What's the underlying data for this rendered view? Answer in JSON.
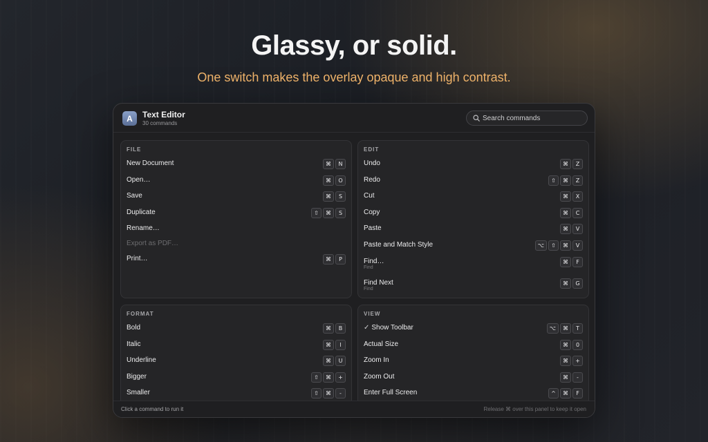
{
  "hero": {
    "title": "Glassy, or solid.",
    "subtitle": "One switch makes the overlay opaque and high contrast."
  },
  "header": {
    "app_icon_letter": "A",
    "app_name": "Text Editor",
    "command_count": "30 commands",
    "search_placeholder": "Search commands"
  },
  "sections": [
    {
      "title": "FILE",
      "items": [
        {
          "label": "New Document",
          "keys": [
            "⌘",
            "N"
          ]
        },
        {
          "label": "Open…",
          "keys": [
            "⌘",
            "O"
          ]
        },
        {
          "label": "Save",
          "keys": [
            "⌘",
            "S"
          ]
        },
        {
          "label": "Duplicate",
          "keys": [
            "⇧",
            "⌘",
            "S"
          ]
        },
        {
          "label": "Rename…",
          "keys": []
        },
        {
          "label": "Export as PDF…",
          "keys": [],
          "disabled": true
        },
        {
          "label": "Print…",
          "keys": [
            "⌘",
            "P"
          ]
        }
      ]
    },
    {
      "title": "EDIT",
      "items": [
        {
          "label": "Undo",
          "keys": [
            "⌘",
            "Z"
          ]
        },
        {
          "label": "Redo",
          "keys": [
            "⇧",
            "⌘",
            "Z"
          ]
        },
        {
          "label": "Cut",
          "keys": [
            "⌘",
            "X"
          ]
        },
        {
          "label": "Copy",
          "keys": [
            "⌘",
            "C"
          ]
        },
        {
          "label": "Paste",
          "keys": [
            "⌘",
            "V"
          ]
        },
        {
          "label": "Paste and Match Style",
          "keys": [
            "⌥",
            "⇧",
            "⌘",
            "V"
          ]
        },
        {
          "label": "Find…",
          "sub": "Find",
          "keys": [
            "⌘",
            "F"
          ]
        },
        {
          "label": "Find Next",
          "sub": "Find",
          "keys": [
            "⌘",
            "G"
          ]
        }
      ]
    },
    {
      "title": "FORMAT",
      "items": [
        {
          "label": "Bold",
          "keys": [
            "⌘",
            "B"
          ]
        },
        {
          "label": "Italic",
          "keys": [
            "⌘",
            "I"
          ]
        },
        {
          "label": "Underline",
          "keys": [
            "⌘",
            "U"
          ]
        },
        {
          "label": "Bigger",
          "keys": [
            "⇧",
            "⌘",
            "+"
          ]
        },
        {
          "label": "Smaller",
          "keys": [
            "⇧",
            "⌘",
            "-"
          ]
        }
      ]
    },
    {
      "title": "VIEW",
      "items": [
        {
          "label": "Show Toolbar",
          "checked": true,
          "keys": [
            "⌥",
            "⌘",
            "T"
          ]
        },
        {
          "label": "Actual Size",
          "keys": [
            "⌘",
            "0"
          ]
        },
        {
          "label": "Zoom In",
          "keys": [
            "⌘",
            "+"
          ]
        },
        {
          "label": "Zoom Out",
          "keys": [
            "⌘",
            "-"
          ]
        },
        {
          "label": "Enter Full Screen",
          "keys": [
            "^",
            "⌘",
            "F"
          ]
        }
      ]
    }
  ],
  "footer": {
    "left_hint": "Click a command to run it",
    "right_hint": "Release ⌘ over this panel to keep it open"
  },
  "colors": {
    "accent_subtitle": "#f2b56b",
    "panel_bg": "#1f1f21",
    "card_bg": "#252527"
  }
}
